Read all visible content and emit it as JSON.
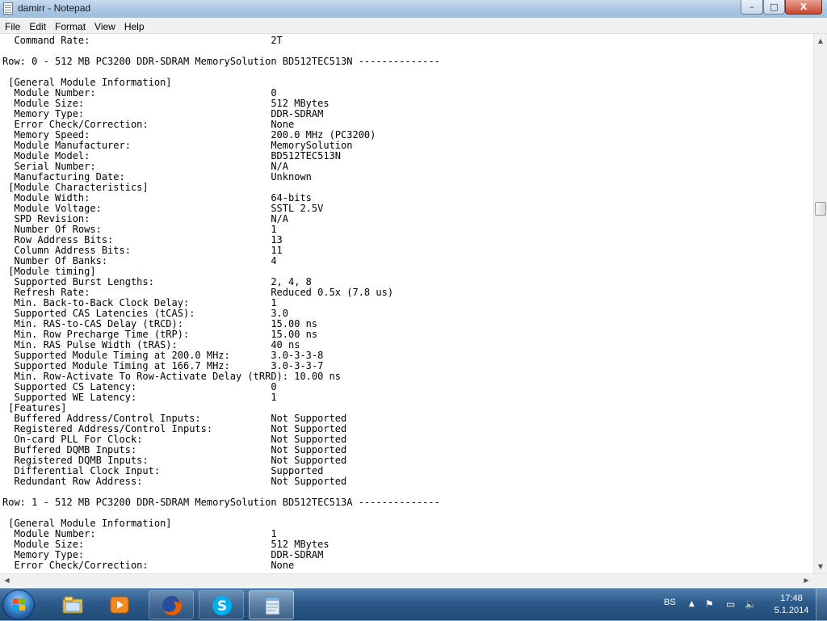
{
  "window": {
    "title": "damirr - Notepad",
    "buttons": {
      "minimize": "–",
      "maximize": "□",
      "close": "X"
    }
  },
  "menu": [
    "File",
    "Edit",
    "Format",
    "View",
    "Help"
  ],
  "document": {
    "lines": [
      "  Command Rate:                               2T",
      "",
      "Row: 0 - 512 MB PC3200 DDR-SDRAM MemorySolution BD512TEC513N --------------",
      "",
      " [General Module Information]",
      "  Module Number:                              0",
      "  Module Size:                                512 MBytes",
      "  Memory Type:                                DDR-SDRAM",
      "  Error Check/Correction:                     None",
      "  Memory Speed:                               200.0 MHz (PC3200)",
      "  Module Manufacturer:                        MemorySolution",
      "  Module Model:                               BD512TEC513N",
      "  Serial Number:                              N/A",
      "  Manufacturing Date:                         Unknown",
      " [Module Characteristics]",
      "  Module Width:                               64-bits",
      "  Module Voltage:                             SSTL 2.5V",
      "  SPD Revision:                               N/A",
      "  Number Of Rows:                             1",
      "  Row Address Bits:                           13",
      "  Column Address Bits:                        11",
      "  Number Of Banks:                            4",
      " [Module timing]",
      "  Supported Burst Lengths:                    2, 4, 8",
      "  Refresh Rate:                               Reduced 0.5x (7.8 us)",
      "  Min. Back-to-Back Clock Delay:              1",
      "  Supported CAS Latencies (tCAS):             3.0",
      "  Min. RAS-to-CAS Delay (tRCD):               15.00 ns",
      "  Min. Row Precharge Time (tRP):              15.00 ns",
      "  Min. RAS Pulse Width (tRAS):                40 ns",
      "  Supported Module Timing at 200.0 MHz:       3.0-3-3-8",
      "  Supported Module Timing at 166.7 MHz:       3.0-3-3-7",
      "  Min. Row-Activate To Row-Activate Delay (tRRD): 10.00 ns",
      "  Supported CS Latency:                       0",
      "  Supported WE Latency:                       1",
      " [Features]",
      "  Buffered Address/Control Inputs:            Not Supported",
      "  Registered Address/Control Inputs:          Not Supported",
      "  On-card PLL For Clock:                      Not Supported",
      "  Buffered DQMB Inputs:                       Not Supported",
      "  Registered DQMB Inputs:                     Not Supported",
      "  Differential Clock Input:                   Supported",
      "  Redundant Row Address:                      Not Supported",
      "",
      "Row: 1 - 512 MB PC3200 DDR-SDRAM MemorySolution BD512TEC513A --------------",
      "",
      " [General Module Information]",
      "  Module Number:                              1",
      "  Module Size:                                512 MBytes",
      "  Memory Type:                                DDR-SDRAM",
      "  Error Check/Correction:                     None"
    ]
  },
  "scrollbars": {
    "vertical_position": 0.31
  },
  "taskbar": {
    "apps": [
      "explorer-icon",
      "media-player-icon",
      "firefox-icon",
      "skype-icon",
      "notepad-icon"
    ],
    "active_app": "notepad-icon",
    "tray": {
      "language": "BS",
      "time": "17:48",
      "date": "5.1.2014"
    }
  },
  "colors": {
    "taskbar": "#2d5a8a",
    "titlebar": "#a9c6e3",
    "close_button": "#c7452d",
    "firefox": "#e66000",
    "skype": "#00aff0"
  }
}
